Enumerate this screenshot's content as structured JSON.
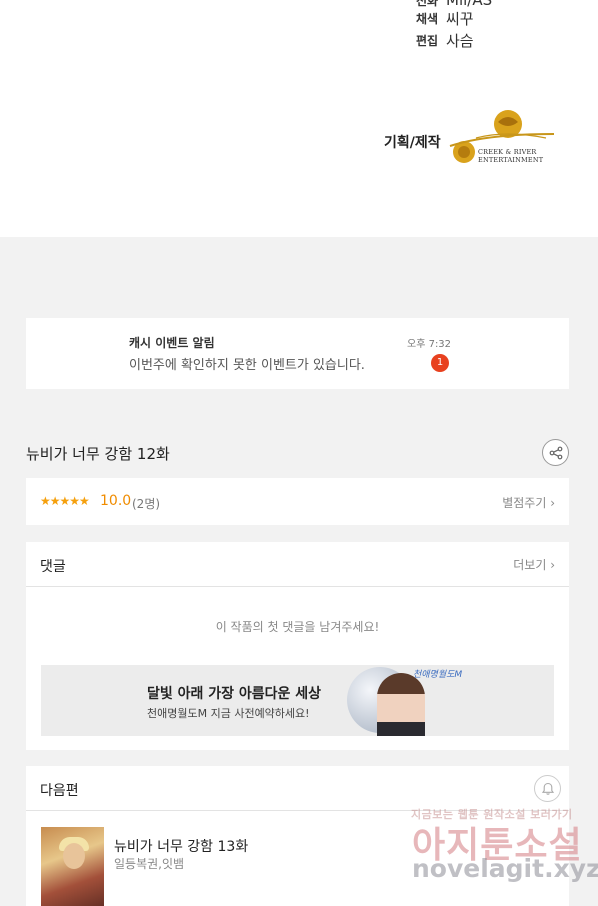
{
  "credits": {
    "rows": [
      {
        "role": "선화",
        "name": "Mil/AS"
      },
      {
        "role": "채색",
        "name": "씨꾸"
      },
      {
        "role": "편집",
        "name": "사슴"
      }
    ],
    "produced_by_label": "기획/제작",
    "logo_text_line1": "CREEK & RIVER",
    "logo_text_line2": "ENTERTAINMENT"
  },
  "notice": {
    "title": "캐시 이벤트 알림",
    "message": "이번주에 확인하지 못한 이벤트가 있습니다.",
    "time": "오후 7:32",
    "badge_count": "1"
  },
  "episode": {
    "title": "뉴비가 너무 강함 12화"
  },
  "rating": {
    "stars": "★★★★★",
    "score": "10.0",
    "count": "(2명)",
    "rate_link": "별점주기 ›"
  },
  "comments": {
    "title": "댓글",
    "more_link": "더보기 ›",
    "empty_message": "이 작품의 첫 댓글을 남겨주세요!",
    "ad": {
      "title": "달빛 아래 가장 아름다운 세상",
      "subtitle": "천애명월도M 지금 사전예약하세요!",
      "logo": "천애명월도M"
    }
  },
  "next_episode": {
    "section_title": "다음편",
    "title": "뉴비가 너무 강함 13화",
    "author": "일등복권,잇뱀"
  },
  "watermark": {
    "line1": "지금보는 웹툰 원작소설 보러가기",
    "line2": "아지툰소설",
    "line3": "novelagit.xyz"
  },
  "colors": {
    "star": "#f5a00d",
    "score": "#f08c00",
    "badge": "#e8411f",
    "page_bg": "#f2f2f2"
  },
  "icons": [
    "share-icon",
    "bell-icon",
    "chevron-right-icon"
  ]
}
